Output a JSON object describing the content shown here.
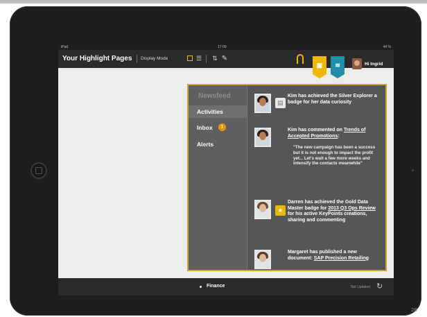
{
  "status_bar": {
    "left": "iPad",
    "center": "17:00",
    "right": "44 %"
  },
  "toolbar": {
    "title": "Your Highlight Pages",
    "display_mode_label": "Display Mode",
    "user_name": "Hi Ingrid"
  },
  "newsfeed": {
    "header": "Newsfeed",
    "nav": [
      {
        "label": "Activities"
      },
      {
        "label": "Inbox",
        "badge": "1"
      },
      {
        "label": "Alerts"
      }
    ],
    "items": [
      {
        "text_before": "Kim has achieved the Silver Explorer a badge for her data curiosity"
      },
      {
        "text_before": "Kim has commented on ",
        "link": "Trends of Accepted Promotions",
        "text_after": ":",
        "quote": "\"The new campaign has been a success but it is not enough to impact the profit yet... Let's wait a few more weeks and intensify the contacts meanwhile\""
      },
      {
        "text_before": "Darren has achieved the Gold Data Master badge for ",
        "link": "2013 Q3 Ops Review",
        "text_after": " for his active KeyPoints creations, sharing and commenting"
      },
      {
        "text_before": "Margaret has published a new document: ",
        "link": "SAP Precision Retailing",
        "text_after": ""
      }
    ]
  },
  "bottom_bar": {
    "section": "Finance",
    "updated": "Not Updated"
  },
  "corner_number": "28",
  "colors": {
    "accent_yellow": "#f2b705",
    "accent_teal": "#1f8ea8",
    "flyout_border": "#c9a43b",
    "badge_orange": "#f29100"
  },
  "icons": [
    "grid-view-icon",
    "list-view-icon",
    "sort-icon",
    "edit-pen-icon",
    "user-profile-icon",
    "bookmark-icon",
    "newsfeed-icon",
    "refresh-icon",
    "badge-icon",
    "star-icon"
  ]
}
